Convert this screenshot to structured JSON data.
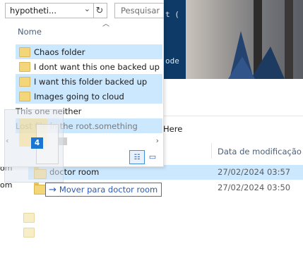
{
  "window": {
    "address": "hypotheti...",
    "search_placeholder": "Pesquisar"
  },
  "icons": {
    "address_chevron": "⌄",
    "refresh": "↻",
    "sort_up": "︿",
    "scroll_left": "‹",
    "scroll_right": "›",
    "details_view": "☷",
    "tiles_view": "▭",
    "move_arrow": "→"
  },
  "dropdown": {
    "column_header": "Nome",
    "items": [
      {
        "label": "Chaos folder",
        "selected": true
      },
      {
        "label": "I dont want this one backed up",
        "selected": false
      },
      {
        "label": "I want this folder backed up",
        "selected": true
      },
      {
        "label": "Images going to cloud",
        "selected": true
      },
      {
        "label": "This one neither",
        "selected": false
      },
      {
        "label": "Lost file in the root.something",
        "selected": true
      }
    ]
  },
  "drag": {
    "count_badge": "4",
    "tooltip": "Mover para doctor room"
  },
  "background": {
    "terminal_lines": [
      "t (",
      "ode"
    ],
    "path_fragment": "Here",
    "column_date": "Data de modificação",
    "rows": [
      {
        "name": "doctor room",
        "date": "27/02/2024 03:57",
        "selected": true
      },
      {
        "name": "",
        "date": "27/02/2024 03:50",
        "selected": false
      }
    ],
    "left_fragments": [
      "om",
      "om"
    ]
  }
}
